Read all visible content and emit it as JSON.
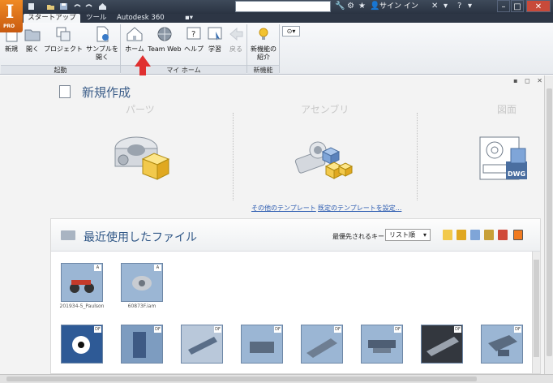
{
  "titlebar": {
    "logo_text": "I",
    "logo_sub": "PRO",
    "signin_label": "サイン イン",
    "search_placeholder": ""
  },
  "tabs": [
    {
      "label": "スタートアップ",
      "active": true
    },
    {
      "label": "ツール",
      "active": false
    },
    {
      "label": "Autodesk 360",
      "active": false
    }
  ],
  "ribbon": {
    "buttons": [
      {
        "label": "新規",
        "icon": "new-file-icon"
      },
      {
        "label": "開く",
        "icon": "open-folder-icon"
      },
      {
        "label": "プロジェクト",
        "icon": "project-icon"
      },
      {
        "label": "サンプルを",
        "label2": "開く",
        "icon": "open-sample-icon"
      },
      {
        "label": "ホーム",
        "icon": "home-icon"
      },
      {
        "label": "Team Web",
        "icon": "globe-icon"
      },
      {
        "label": "ヘルプ",
        "icon": "help-icon"
      },
      {
        "label": "学習",
        "icon": "learn-icon"
      },
      {
        "label": "戻る",
        "icon": "back-icon"
      },
      {
        "label": "新機能の",
        "label2": "紹介",
        "icon": "new-features-icon"
      }
    ],
    "groups": [
      {
        "label": "起動"
      },
      {
        "label": "マイ ホーム"
      },
      {
        "label": "新機能"
      }
    ]
  },
  "newdoc": {
    "title": "新規作成",
    "templates": [
      {
        "label": "パーツ"
      },
      {
        "label": "アセンブリ"
      },
      {
        "label": "図面",
        "badge": "DWG"
      }
    ],
    "links": [
      {
        "label": "その他のテンプレート"
      },
      {
        "label": "既定のテンプレートを設定..."
      }
    ]
  },
  "recent": {
    "title": "最近使用したファイル",
    "sort_label": "最優先されるキー",
    "sort_value": "リスト順",
    "files_row1": [
      {
        "name": "201934-5_Paulson",
        "badge": "A"
      },
      {
        "name": "60873F.iam",
        "badge": "A"
      }
    ],
    "files_row2": [
      {
        "name": "",
        "badge": "DF"
      },
      {
        "name": "",
        "badge": "DF"
      },
      {
        "name": "",
        "badge": "DF"
      },
      {
        "name": "",
        "badge": "DF"
      },
      {
        "name": "",
        "badge": "DF"
      },
      {
        "name": "",
        "badge": "DF"
      },
      {
        "name": "",
        "badge": "DF"
      },
      {
        "name": "",
        "badge": "DF"
      }
    ]
  },
  "colors": {
    "accent_title": "#3a5c88",
    "link": "#2a5ab0",
    "logo": "#e8781e",
    "pointer": "#e03030"
  }
}
